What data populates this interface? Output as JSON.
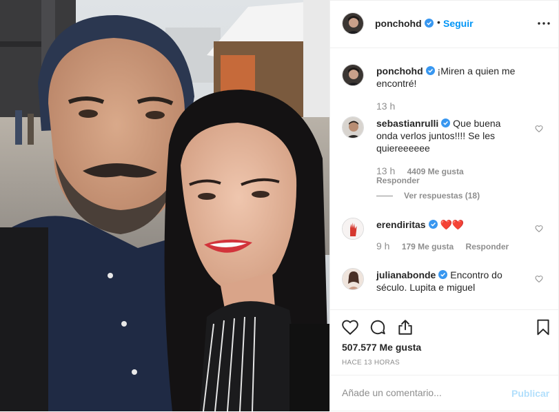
{
  "post": {
    "author": "ponchohd",
    "follow_label": "Seguir",
    "separator": "•",
    "more_icon": "more-horizontal-icon",
    "caption": "¡Miren a quien me encontré!",
    "caption_time": "13 h"
  },
  "comments": [
    {
      "username": "sebastianrulli",
      "text": "Que buena onda verlos juntos!!!! Se les quiereeeeee",
      "time": "13 h",
      "likes": "4409 Me gusta",
      "reply_label": "Responder",
      "view_replies": "Ver respuestas (18)"
    },
    {
      "username": "erendiritas",
      "text": "❤️❤️",
      "time": "9 h",
      "likes": "179 Me gusta",
      "reply_label": "Responder"
    },
    {
      "username": "julianabonde",
      "text": "Encontro do século. Lupita e miguel"
    }
  ],
  "actions": {
    "like_icon": "heart-icon",
    "comment_icon": "comment-icon",
    "share_icon": "share-icon",
    "save_icon": "bookmark-icon",
    "likes_count": "507.577 Me gusta",
    "timestamp": "HACE 13 HORAS"
  },
  "add_comment": {
    "placeholder": "Añade un comentario...",
    "publish_label": "Publicar"
  },
  "colors": {
    "link_blue": "#0095f6",
    "verified_blue": "#3897f0",
    "publish_disabled": "#b2dffc",
    "secondary_text": "#8e8e8e"
  }
}
